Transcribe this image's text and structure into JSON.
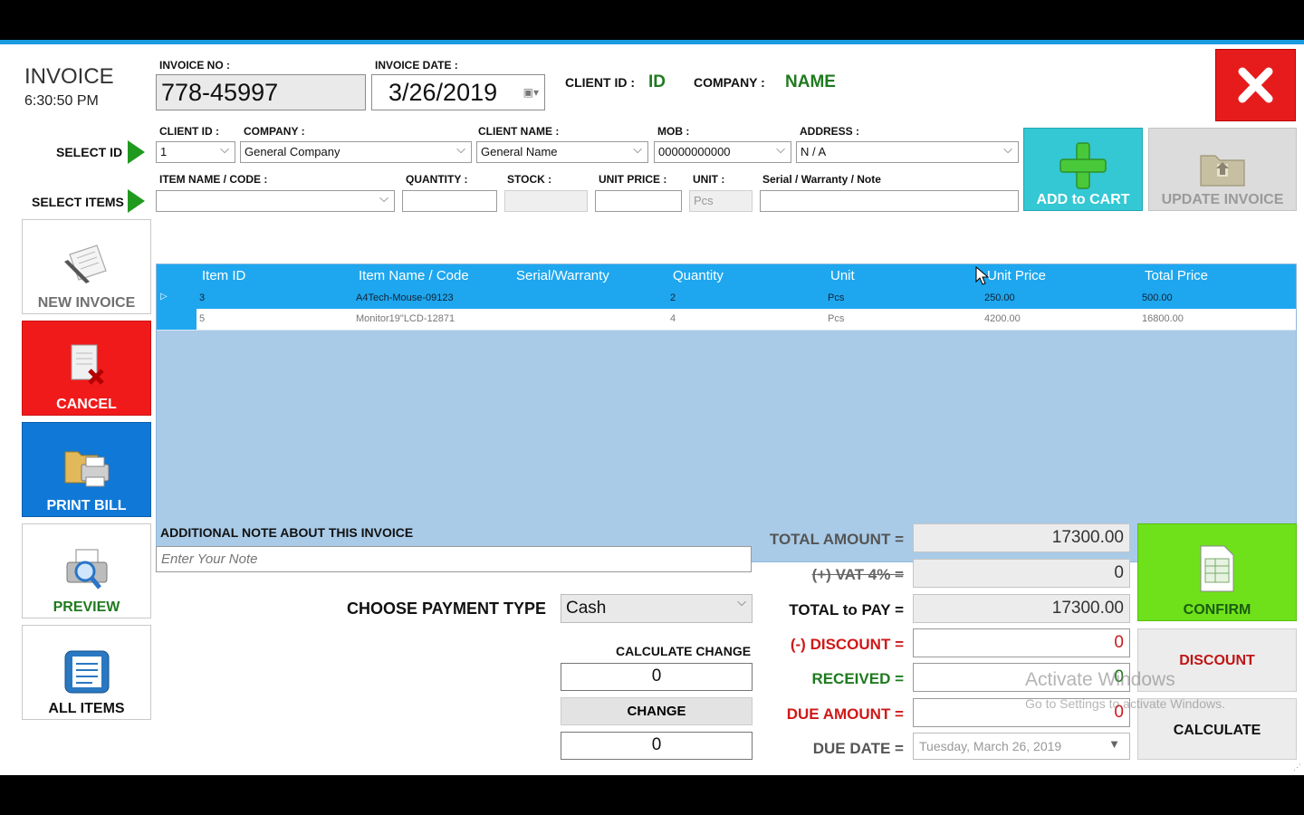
{
  "header": {
    "title": "INVOICE",
    "time": "6:30:50 PM",
    "invoice_no_label": "INVOICE NO :",
    "invoice_no": "778-45997",
    "invoice_date_label": "INVOICE DATE :",
    "invoice_date": "3/26/2019",
    "client_id_label": "CLIENT ID :",
    "client_id_value": "ID",
    "company_label": "COMPANY :",
    "company_value": "NAME"
  },
  "selectors": {
    "select_id_label": "SELECT ID",
    "select_items_label": "SELECT ITEMS",
    "client_id_label": "CLIENT ID :",
    "client_id": "1",
    "company_label": "COMPANY :",
    "company": "General Company",
    "client_name_label": "CLIENT NAME :",
    "client_name": "General Name",
    "mob_label": "MOB :",
    "mob": "00000000000",
    "address_label": "ADDRESS :",
    "address": "N / A",
    "item_name_label": "ITEM NAME / CODE :",
    "item_name": "",
    "quantity_label": "QUANTITY :",
    "quantity": "",
    "stock_label": "STOCK :",
    "stock": "",
    "unit_price_label": "UNIT PRICE :",
    "unit_price": "",
    "unit_label": "UNIT :",
    "unit": "Pcs",
    "serial_label": "Serial / Warranty / Note",
    "serial": ""
  },
  "buttons": {
    "add_to_cart": "ADD to CART",
    "update_invoice": "UPDATE INVOICE",
    "new_invoice": "NEW INVOICE",
    "cancel": "CANCEL",
    "print_bill": "PRINT BILL",
    "preview": "PREVIEW",
    "all_items": "ALL ITEMS",
    "confirm": "CONFIRM",
    "discount": "DISCOUNT",
    "calculate": "CALCULATE",
    "change": "CHANGE"
  },
  "grid": {
    "columns": [
      "Item ID",
      "Item Name / Code",
      "Serial/Warranty",
      "Quantity",
      "Unit",
      "Unit Price",
      "Total Price"
    ],
    "rows": [
      {
        "id": "3",
        "name": "A4Tech-Mouse-09123",
        "serial": "",
        "qty": "2",
        "unit": "Pcs",
        "unit_price": "250.00",
        "total": "500.00"
      },
      {
        "id": "5",
        "name": "Monitor19\"LCD-12871",
        "serial": "",
        "qty": "4",
        "unit": "Pcs",
        "unit_price": "4200.00",
        "total": "16800.00"
      }
    ]
  },
  "notes": {
    "label": "ADDITIONAL NOTE ABOUT THIS INVOICE",
    "placeholder": "Enter Your Note"
  },
  "payment": {
    "type_label": "CHOOSE PAYMENT TYPE",
    "type": "Cash",
    "calc_change_label": "CALCULATE CHANGE",
    "calc_value": "0",
    "change_value": "0"
  },
  "totals": {
    "total_amount_label": "TOTAL AMOUNT =",
    "total_amount": "17300.00",
    "vat_label": "(+) VAT 4% =",
    "vat": "0",
    "total_to_pay_label": "TOTAL to PAY =",
    "total_to_pay": "17300.00",
    "discount_label": "(-) DISCOUNT =",
    "discount": "0",
    "received_label": "RECEIVED =",
    "received": "0",
    "due_amount_label": "DUE AMOUNT =",
    "due_amount": "0",
    "due_date_label": "DUE DATE =",
    "due_date": "Tuesday, March 26, 2019"
  },
  "watermark": {
    "line1": "Activate Windows",
    "line2": "Go to Settings to activate Windows."
  },
  "colors": {
    "accent_blue": "#1ea7ef",
    "grid_bg": "#a9cbe8",
    "cancel_red": "#f11a1a",
    "print_blue": "#1078d6",
    "confirm_green": "#6fe11b",
    "add_teal": "#33c8d4",
    "label_green": "#1f7a1f",
    "label_red": "#d01818"
  }
}
